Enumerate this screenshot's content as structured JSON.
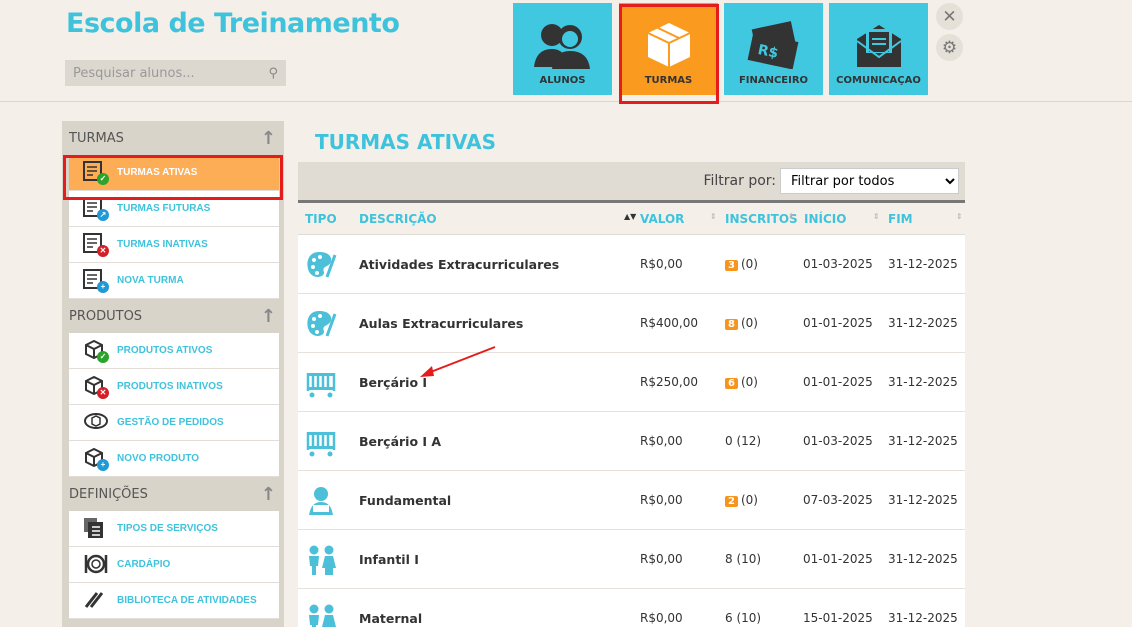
{
  "header": {
    "title": "Escola de Treinamento",
    "search_placeholder": "Pesquisar alunos..."
  },
  "nav": [
    {
      "label": "ALUNOS"
    },
    {
      "label": "TURMAS",
      "active": true
    },
    {
      "label": "FINANCEIRO"
    },
    {
      "label": "COMUNICAÇAO"
    }
  ],
  "sidebar": {
    "sections": [
      {
        "title": "TURMAS",
        "items": [
          "TURMAS ATIVAS",
          "TURMAS FUTURAS",
          "TURMAS INATIVAS",
          "NOVA TURMA"
        ]
      },
      {
        "title": "PRODUTOS",
        "items": [
          "PRODUTOS ATIVOS",
          "PRODUTOS INATIVOS",
          "GESTÃO DE PEDIDOS",
          "NOVO PRODUTO"
        ]
      },
      {
        "title": "DEFINIÇÕES",
        "items": [
          "TIPOS DE SERVIÇOS",
          "CARDÁPIO",
          "BIBLIOTECA DE ATIVIDADES"
        ]
      }
    ]
  },
  "main": {
    "title": "TURMAS ATIVAS",
    "filter_label": "Filtrar por:",
    "filter_value": "Filtrar por todos",
    "columns": [
      "TIPO",
      "DESCRIÇÃO",
      "VALOR",
      "INSCRITOS",
      "INÍCIO",
      "FIM"
    ],
    "rows": [
      {
        "icon": "palette",
        "desc": "Atividades Extracurriculares",
        "valor": "R$0,00",
        "badge": "3",
        "inscritos": "(0)",
        "inicio": "01-03-2025",
        "fim": "31-12-2025"
      },
      {
        "icon": "palette",
        "desc": "Aulas Extracurriculares",
        "valor": "R$400,00",
        "badge": "8",
        "inscritos": "(0)",
        "inicio": "01-01-2025",
        "fim": "31-12-2025"
      },
      {
        "icon": "crib",
        "desc": "Berçário I",
        "valor": "R$250,00",
        "badge": "6",
        "inscritos": "(0)",
        "inicio": "01-01-2025",
        "fim": "31-12-2025"
      },
      {
        "icon": "crib",
        "desc": "Berçário I A",
        "valor": "R$0,00",
        "badge": "",
        "inscritos": "0 (12)",
        "inicio": "01-03-2025",
        "fim": "31-12-2025"
      },
      {
        "icon": "reader",
        "desc": "Fundamental",
        "valor": "R$0,00",
        "badge": "2",
        "inscritos": "(0)",
        "inicio": "07-03-2025",
        "fim": "31-12-2025"
      },
      {
        "icon": "kids",
        "desc": "Infantil I",
        "valor": "R$0,00",
        "badge": "",
        "inscritos": "8 (10)",
        "inicio": "01-01-2025",
        "fim": "31-12-2025"
      },
      {
        "icon": "kids",
        "desc": "Maternal",
        "valor": "R$0,00",
        "badge": "",
        "inscritos": "6 (10)",
        "inicio": "15-01-2025",
        "fim": "31-12-2025"
      }
    ]
  },
  "colors": {
    "accent": "#3fc3dc",
    "orange": "#fa9a1f",
    "highlight": "#e51c1c"
  }
}
